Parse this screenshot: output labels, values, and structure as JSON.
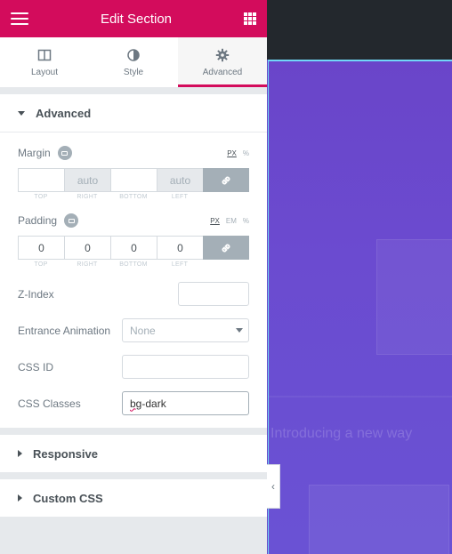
{
  "header": {
    "title": "Edit Section"
  },
  "tabs": [
    {
      "label": "Layout",
      "icon": "layout-icon"
    },
    {
      "label": "Style",
      "icon": "contrast-icon"
    },
    {
      "label": "Advanced",
      "icon": "gear-icon"
    }
  ],
  "sections": {
    "advanced": {
      "title": "Advanced",
      "margin": {
        "label": "Margin",
        "units": [
          "PX",
          "%"
        ],
        "active_unit": "PX",
        "fields": [
          {
            "label": "TOP",
            "value": "",
            "placeholder": ""
          },
          {
            "label": "RIGHT",
            "value": "",
            "placeholder": "auto"
          },
          {
            "label": "BOTTOM",
            "value": "",
            "placeholder": ""
          },
          {
            "label": "LEFT",
            "value": "",
            "placeholder": "auto"
          }
        ]
      },
      "padding": {
        "label": "Padding",
        "units": [
          "PX",
          "EM",
          "%"
        ],
        "active_unit": "PX",
        "fields": [
          {
            "label": "TOP",
            "value": "0"
          },
          {
            "label": "RIGHT",
            "value": "0"
          },
          {
            "label": "BOTTOM",
            "value": "0"
          },
          {
            "label": "LEFT",
            "value": "0"
          }
        ]
      },
      "z_index": {
        "label": "Z-Index",
        "value": ""
      },
      "entrance_animation": {
        "label": "Entrance Animation",
        "value": "None"
      },
      "css_id": {
        "label": "CSS ID",
        "value": ""
      },
      "css_classes": {
        "label": "CSS Classes",
        "value_misspelled": "bg",
        "value_rest": "-dark"
      }
    },
    "responsive": {
      "title": "Responsive"
    },
    "custom_css": {
      "title": "Custom CSS"
    }
  },
  "preview": {
    "heading": "Introducing a new way"
  },
  "colors": {
    "brand": "#d30c5c",
    "preview_bg": "#6a47c8",
    "topbar": "#23282d"
  }
}
